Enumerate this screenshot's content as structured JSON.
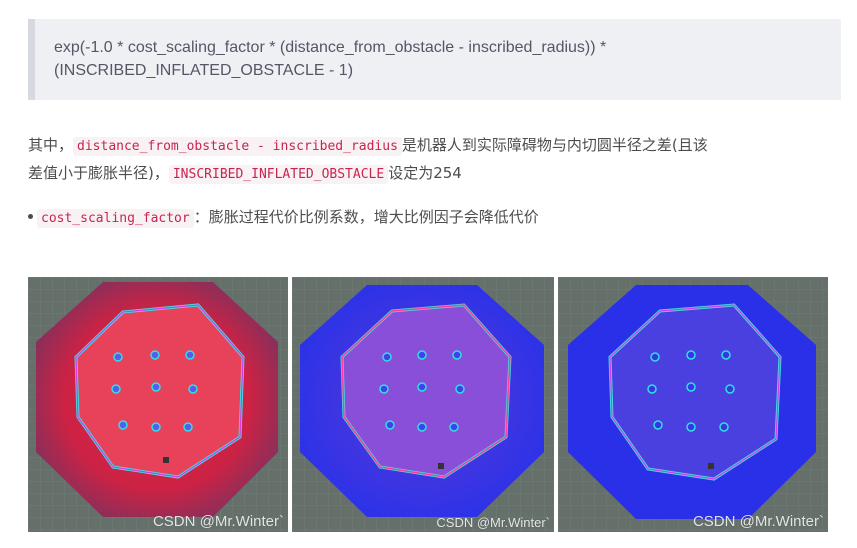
{
  "formula": {
    "line1": "exp(-1.0 * cost_scaling_factor * (distance_from_obstacle - inscribed_radius)) *",
    "line2": "(INSCRIBED_INFLATED_OBSTACLE - 1)"
  },
  "paragraph": {
    "prefix": "其中，",
    "code1": "distance_from_obstacle - inscribed_radius",
    "mid1": "是机器人到实际障碍物与内切圆半径之差(且该",
    "mid2": "差值小于膨胀半径)，",
    "code2": "INSCRIBED_INFLATED_OBSTACLE",
    "suffix": "设定为254"
  },
  "bullet": {
    "code": "cost_scaling_factor",
    "text": "：膨胀过程代价比例系数，增大比例因子会降低代价"
  },
  "images": [
    {
      "watermark": "CSDN @Mr.Winter`",
      "theme": "red"
    },
    {
      "watermark": "CSDN @Mr.Winter`",
      "theme": "mixed"
    },
    {
      "watermark": "CSDN @Mr.Winter`",
      "theme": "blue"
    }
  ],
  "colors": {
    "code_text": "#c7254e",
    "code_bg": "#f9f2f4",
    "quote_bg": "#eef0f4",
    "grid_bg": "#65706b"
  }
}
